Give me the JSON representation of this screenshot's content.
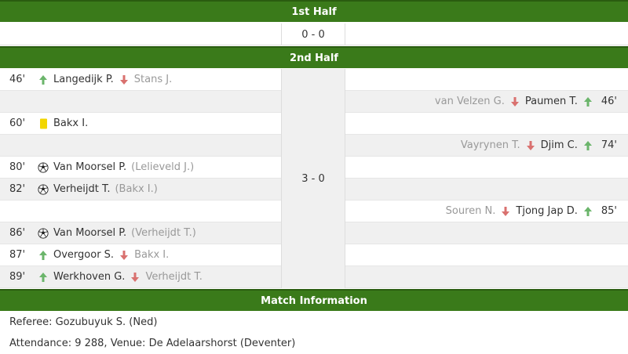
{
  "colors": {
    "header_bg": "#3a7a1a",
    "arrow_in": "#6bb56b",
    "arrow_out": "#d9716f",
    "yellow_card": "#f2d600"
  },
  "first_half": {
    "title": "1st Half",
    "score": "0 - 0"
  },
  "second_half": {
    "title": "2nd Half",
    "score": "3 - 0"
  },
  "events": [
    {
      "side": "home",
      "minute": "46'",
      "type": "sub",
      "player": "Langedijk P.",
      "secondary": "Stans J."
    },
    {
      "side": "away",
      "minute": "46'",
      "type": "sub",
      "player": "Paumen T.",
      "secondary": "van Velzen G."
    },
    {
      "side": "home",
      "minute": "60'",
      "type": "yellow-card",
      "player": "Bakx I.",
      "secondary": ""
    },
    {
      "side": "away",
      "minute": "74'",
      "type": "sub",
      "player": "Djim C.",
      "secondary": "Vayrynen T."
    },
    {
      "side": "home",
      "minute": "80'",
      "type": "goal",
      "player": "Van Moorsel P.",
      "secondary": "(Lelieveld J.)"
    },
    {
      "side": "home",
      "minute": "82'",
      "type": "goal",
      "player": "Verheijdt T.",
      "secondary": "(Bakx I.)"
    },
    {
      "side": "away",
      "minute": "85'",
      "type": "sub",
      "player": "Tjong Jap D.",
      "secondary": "Souren N."
    },
    {
      "side": "home",
      "minute": "86'",
      "type": "goal",
      "player": "Van Moorsel P.",
      "secondary": "(Verheijdt T.)"
    },
    {
      "side": "home",
      "minute": "87'",
      "type": "sub",
      "player": "Overgoor S.",
      "secondary": "Bakx I."
    },
    {
      "side": "home",
      "minute": "89'",
      "type": "sub",
      "player": "Werkhoven G.",
      "secondary": "Verheijdt T."
    }
  ],
  "match_info": {
    "title": "Match Information",
    "referee": "Referee: Gozubuyuk S. (Ned)",
    "attendance_venue": "Attendance: 9 288,  Venue: De Adelaarshorst (Deventer)"
  }
}
